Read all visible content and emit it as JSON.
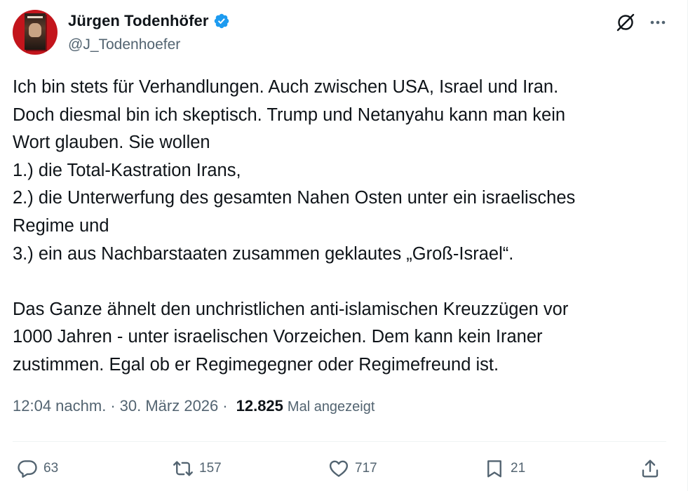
{
  "author": {
    "display_name": "Jürgen Todenhöfer",
    "handle": "@J_Todenhoefer",
    "verified": true,
    "verified_color": "#1d9bf0",
    "avatar_color": "#c3151c"
  },
  "tweet": {
    "text": "Ich bin stets für Verhandlungen. Auch zwischen USA, Israel und Iran.\nDoch diesmal bin ich skeptisch. Trump und Netanyahu kann man kein\nWort glauben. Sie wollen\n1.) die Total-Kastration Irans,\n2.) die Unterwerfung des gesamten Nahen Osten unter ein israelisches\nRegime und\n3.) ein aus Nachbarstaaten zusammen geklautes „Groß-Israel“.\n\nDas Ganze ähnelt den unchristlichen anti-islamischen Kreuzzügen vor\n1000 Jahren - unter israelischen Vorzeichen. Dem kann kein Iraner\nzustimmen. Egal ob er Regimegegner oder Regimefreund ist.",
    "time": "12:04 nachm.",
    "separator": "·",
    "date": "30. März 2026",
    "views_count": "12.825",
    "views_label": "Mal angezeigt"
  },
  "actions": {
    "replies": "63",
    "retweets": "157",
    "likes": "717",
    "bookmarks": "21"
  },
  "colors": {
    "text": "#0f1419",
    "secondary": "#536471",
    "divider": "#eff3f4"
  },
  "icons": [
    "verified-badge-icon",
    "grok-icon",
    "more-icon",
    "reply-icon",
    "retweet-icon",
    "like-icon",
    "bookmark-icon",
    "share-icon"
  ]
}
